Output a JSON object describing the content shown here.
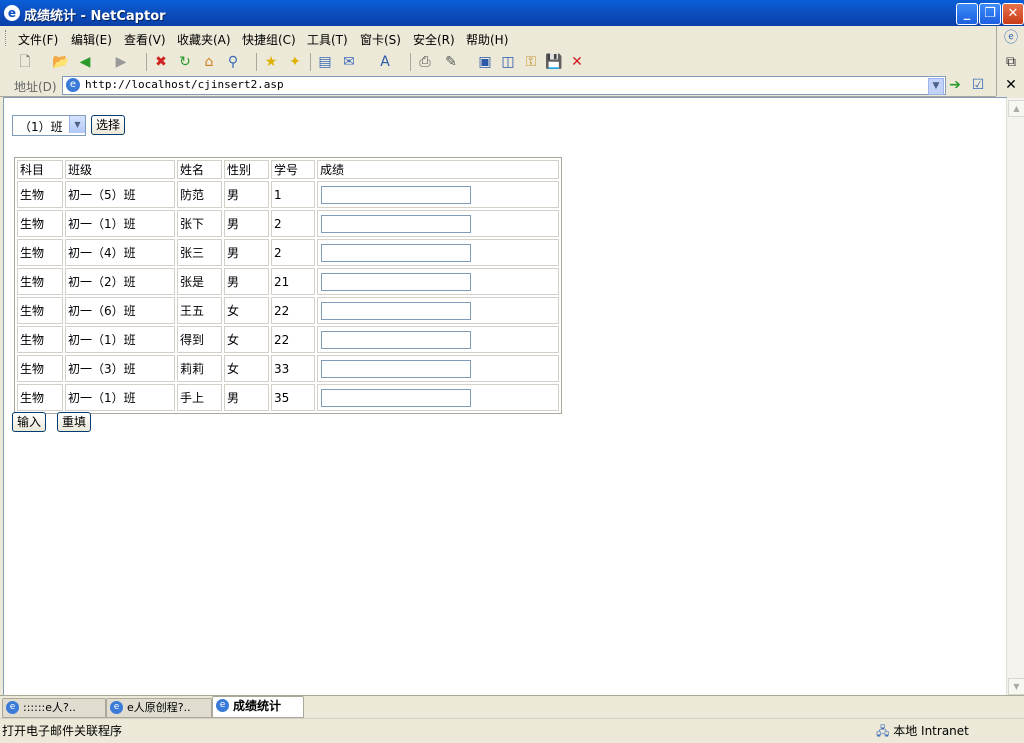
{
  "window": {
    "title": "成绩统计 - NetCaptor",
    "buttons": {
      "minimize": "_",
      "restore": "❐",
      "close": "✕"
    }
  },
  "menubar": {
    "items": [
      "文件(F)",
      "编辑(E)",
      "查看(V)",
      "收藏夹(A)",
      "快捷组(C)",
      "工具(T)",
      "窗卡(S)",
      "安全(R)",
      "帮助(H)"
    ]
  },
  "toolbar": {
    "icons": [
      "new-page-icon",
      "open-folder-icon",
      "back-icon",
      "forward-icon",
      "stop-icon",
      "refresh-icon",
      "home-icon",
      "search-icon",
      "favorites-icon",
      "add-favorite-icon",
      "sidebar-icon",
      "mail-icon",
      "font-icon",
      "print-icon",
      "edit-icon",
      "page-icon",
      "window-icon",
      "key-icon",
      "save-icon",
      "close-icon"
    ]
  },
  "address": {
    "label": "地址(D)",
    "url": "http://localhost/cjinsert2.asp"
  },
  "page": {
    "class_select": {
      "value": "（1）班"
    },
    "select_button": "选择",
    "table": {
      "headers": [
        "科目",
        "班级",
        "姓名",
        "性别",
        "学号",
        "成绩"
      ],
      "rows": [
        [
          "生物",
          "初一（5）班",
          "防范",
          "男",
          "1"
        ],
        [
          "生物",
          "初一（1）班",
          "张下",
          "男",
          "2"
        ],
        [
          "生物",
          "初一（4）班",
          "张三",
          "男",
          "2"
        ],
        [
          "生物",
          "初一（2）班",
          "张是",
          "男",
          "21"
        ],
        [
          "生物",
          "初一（6）班",
          "王五",
          "女",
          "22"
        ],
        [
          "生物",
          "初一（1）班",
          "得到",
          "女",
          "22"
        ],
        [
          "生物",
          "初一（3）班",
          "莉莉",
          "女",
          "33"
        ],
        [
          "生物",
          "初一（1）班",
          "手上",
          "男",
          "35"
        ]
      ]
    },
    "submit_button": "输入",
    "reset_button": "重填"
  },
  "tabs": [
    {
      "label": "::::::e人?..",
      "active": false
    },
    {
      "label": "e人原创程?..",
      "active": false
    },
    {
      "label": "成绩统计",
      "active": true
    }
  ],
  "status": {
    "text": "打开电子邮件关联程序",
    "zone": "本地 Intranet"
  },
  "colors": {
    "title_bar": "#0c4fc0",
    "chrome": "#ece9d8",
    "input_border": "#7f9db9"
  }
}
